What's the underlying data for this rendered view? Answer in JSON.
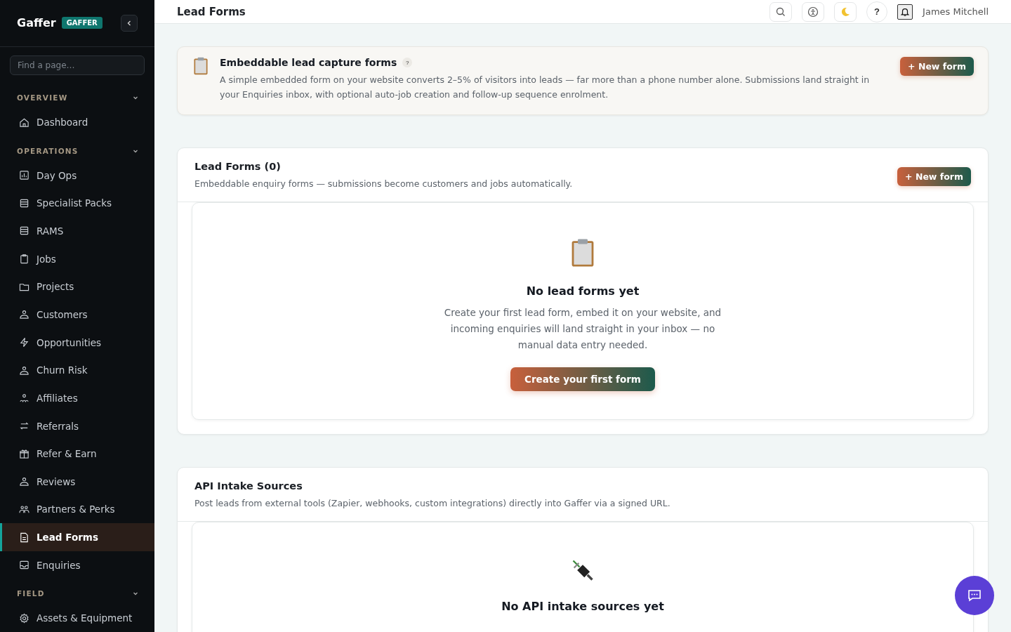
{
  "sidebar": {
    "brand": "Gaffer",
    "badge": "GAFFER",
    "search": {
      "placeholder": "Find a page…"
    },
    "sections": [
      {
        "title": "OVERVIEW",
        "expanded": true,
        "items": [
          {
            "label": "Dashboard",
            "selected": false
          }
        ]
      },
      {
        "title": "OPERATIONS",
        "expanded": true,
        "items": [
          {
            "label": "Day Ops",
            "selected": false
          },
          {
            "label": "Specialist Packs",
            "selected": false
          },
          {
            "label": "RAMS",
            "selected": false
          },
          {
            "label": "Jobs",
            "selected": false
          },
          {
            "label": "Projects",
            "selected": false
          },
          {
            "label": "Customers",
            "selected": false
          },
          {
            "label": "Opportunities",
            "selected": false
          },
          {
            "label": "Churn Risk",
            "selected": false
          },
          {
            "label": "Affiliates",
            "selected": false
          },
          {
            "label": "Referrals",
            "selected": false
          },
          {
            "label": "Refer & Earn",
            "selected": false
          },
          {
            "label": "Reviews",
            "selected": false
          },
          {
            "label": "Partners & Perks",
            "selected": false
          },
          {
            "label": "Lead Forms",
            "selected": true
          },
          {
            "label": "Enquiries",
            "selected": false
          }
        ]
      },
      {
        "title": "FIELD",
        "expanded": true,
        "items": [
          {
            "label": "Assets & Equipment",
            "selected": false
          }
        ]
      }
    ]
  },
  "topbar": {
    "title": "Lead Forms",
    "help": "?",
    "user": "James Mitchell"
  },
  "intro": {
    "title": "Embeddable lead capture forms",
    "help": "?",
    "text": "A simple embedded form on your website converts 2–5% of visitors into leads — far more than a phone number alone. Submissions land straight in your Enquiries inbox, with optional auto-job creation and follow-up sequence enrolment.",
    "button": "+ New form"
  },
  "panels": [
    {
      "title": "Lead Forms (0)",
      "subtitle": "Embeddable enquiry forms — submissions become customers and jobs automatically.",
      "button": "+ New form",
      "empty": {
        "kind": "clipboard",
        "title": "No lead forms yet",
        "text": "Create your first lead form, embed it on your website, and incoming enquiries will land straight in your inbox — no manual data entry needed.",
        "button": "Create your first form"
      }
    },
    {
      "title": "API Intake Sources",
      "subtitle": "Post leads from external tools (Zapier, webhooks, custom integrations) directly into Gaffer via a signed URL.",
      "empty": {
        "kind": "plug",
        "title": "No API intake sources yet"
      }
    }
  ]
}
